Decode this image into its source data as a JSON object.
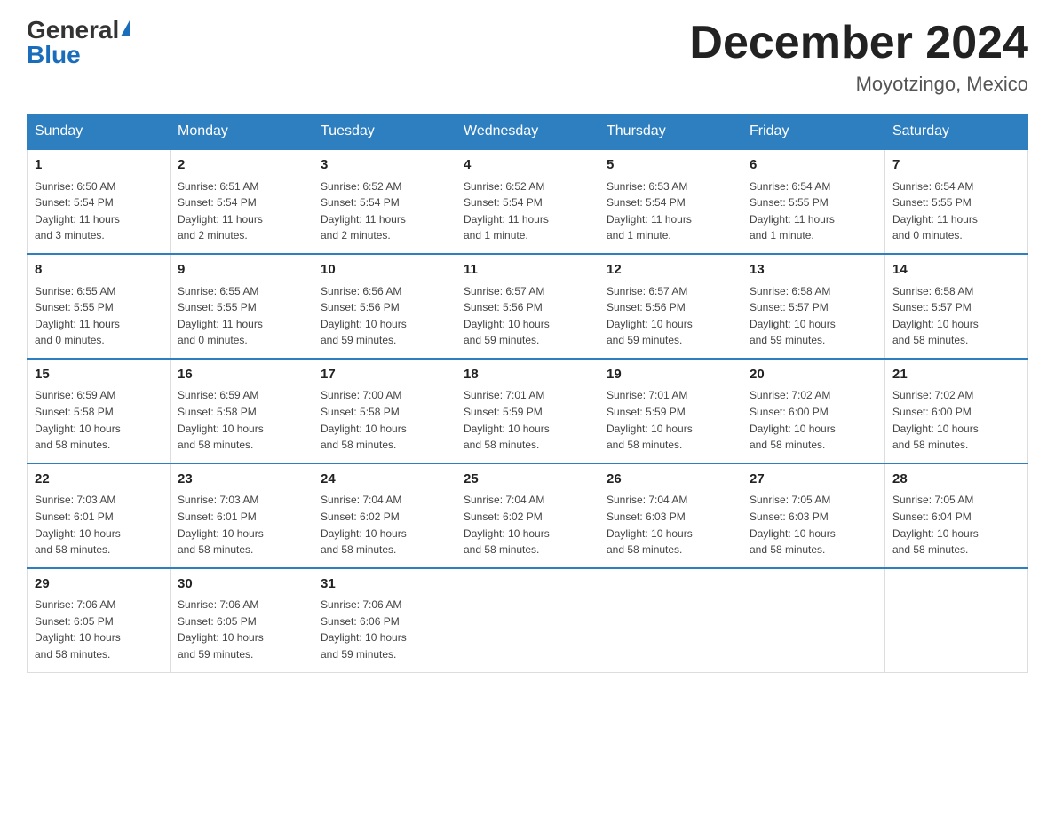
{
  "header": {
    "logo_general": "General",
    "logo_blue": "Blue",
    "title": "December 2024",
    "subtitle": "Moyotzingo, Mexico"
  },
  "days_of_week": [
    "Sunday",
    "Monday",
    "Tuesday",
    "Wednesday",
    "Thursday",
    "Friday",
    "Saturday"
  ],
  "weeks": [
    [
      {
        "num": "1",
        "sunrise": "6:50 AM",
        "sunset": "5:54 PM",
        "daylight": "11 hours and 3 minutes."
      },
      {
        "num": "2",
        "sunrise": "6:51 AM",
        "sunset": "5:54 PM",
        "daylight": "11 hours and 2 minutes."
      },
      {
        "num": "3",
        "sunrise": "6:52 AM",
        "sunset": "5:54 PM",
        "daylight": "11 hours and 2 minutes."
      },
      {
        "num": "4",
        "sunrise": "6:52 AM",
        "sunset": "5:54 PM",
        "daylight": "11 hours and 1 minute."
      },
      {
        "num": "5",
        "sunrise": "6:53 AM",
        "sunset": "5:54 PM",
        "daylight": "11 hours and 1 minute."
      },
      {
        "num": "6",
        "sunrise": "6:54 AM",
        "sunset": "5:55 PM",
        "daylight": "11 hours and 1 minute."
      },
      {
        "num": "7",
        "sunrise": "6:54 AM",
        "sunset": "5:55 PM",
        "daylight": "11 hours and 0 minutes."
      }
    ],
    [
      {
        "num": "8",
        "sunrise": "6:55 AM",
        "sunset": "5:55 PM",
        "daylight": "11 hours and 0 minutes."
      },
      {
        "num": "9",
        "sunrise": "6:55 AM",
        "sunset": "5:55 PM",
        "daylight": "11 hours and 0 minutes."
      },
      {
        "num": "10",
        "sunrise": "6:56 AM",
        "sunset": "5:56 PM",
        "daylight": "10 hours and 59 minutes."
      },
      {
        "num": "11",
        "sunrise": "6:57 AM",
        "sunset": "5:56 PM",
        "daylight": "10 hours and 59 minutes."
      },
      {
        "num": "12",
        "sunrise": "6:57 AM",
        "sunset": "5:56 PM",
        "daylight": "10 hours and 59 minutes."
      },
      {
        "num": "13",
        "sunrise": "6:58 AM",
        "sunset": "5:57 PM",
        "daylight": "10 hours and 59 minutes."
      },
      {
        "num": "14",
        "sunrise": "6:58 AM",
        "sunset": "5:57 PM",
        "daylight": "10 hours and 58 minutes."
      }
    ],
    [
      {
        "num": "15",
        "sunrise": "6:59 AM",
        "sunset": "5:58 PM",
        "daylight": "10 hours and 58 minutes."
      },
      {
        "num": "16",
        "sunrise": "6:59 AM",
        "sunset": "5:58 PM",
        "daylight": "10 hours and 58 minutes."
      },
      {
        "num": "17",
        "sunrise": "7:00 AM",
        "sunset": "5:58 PM",
        "daylight": "10 hours and 58 minutes."
      },
      {
        "num": "18",
        "sunrise": "7:01 AM",
        "sunset": "5:59 PM",
        "daylight": "10 hours and 58 minutes."
      },
      {
        "num": "19",
        "sunrise": "7:01 AM",
        "sunset": "5:59 PM",
        "daylight": "10 hours and 58 minutes."
      },
      {
        "num": "20",
        "sunrise": "7:02 AM",
        "sunset": "6:00 PM",
        "daylight": "10 hours and 58 minutes."
      },
      {
        "num": "21",
        "sunrise": "7:02 AM",
        "sunset": "6:00 PM",
        "daylight": "10 hours and 58 minutes."
      }
    ],
    [
      {
        "num": "22",
        "sunrise": "7:03 AM",
        "sunset": "6:01 PM",
        "daylight": "10 hours and 58 minutes."
      },
      {
        "num": "23",
        "sunrise": "7:03 AM",
        "sunset": "6:01 PM",
        "daylight": "10 hours and 58 minutes."
      },
      {
        "num": "24",
        "sunrise": "7:04 AM",
        "sunset": "6:02 PM",
        "daylight": "10 hours and 58 minutes."
      },
      {
        "num": "25",
        "sunrise": "7:04 AM",
        "sunset": "6:02 PM",
        "daylight": "10 hours and 58 minutes."
      },
      {
        "num": "26",
        "sunrise": "7:04 AM",
        "sunset": "6:03 PM",
        "daylight": "10 hours and 58 minutes."
      },
      {
        "num": "27",
        "sunrise": "7:05 AM",
        "sunset": "6:03 PM",
        "daylight": "10 hours and 58 minutes."
      },
      {
        "num": "28",
        "sunrise": "7:05 AM",
        "sunset": "6:04 PM",
        "daylight": "10 hours and 58 minutes."
      }
    ],
    [
      {
        "num": "29",
        "sunrise": "7:06 AM",
        "sunset": "6:05 PM",
        "daylight": "10 hours and 58 minutes."
      },
      {
        "num": "30",
        "sunrise": "7:06 AM",
        "sunset": "6:05 PM",
        "daylight": "10 hours and 59 minutes."
      },
      {
        "num": "31",
        "sunrise": "7:06 AM",
        "sunset": "6:06 PM",
        "daylight": "10 hours and 59 minutes."
      },
      null,
      null,
      null,
      null
    ]
  ],
  "labels": {
    "sunrise": "Sunrise:",
    "sunset": "Sunset:",
    "daylight": "Daylight:"
  }
}
